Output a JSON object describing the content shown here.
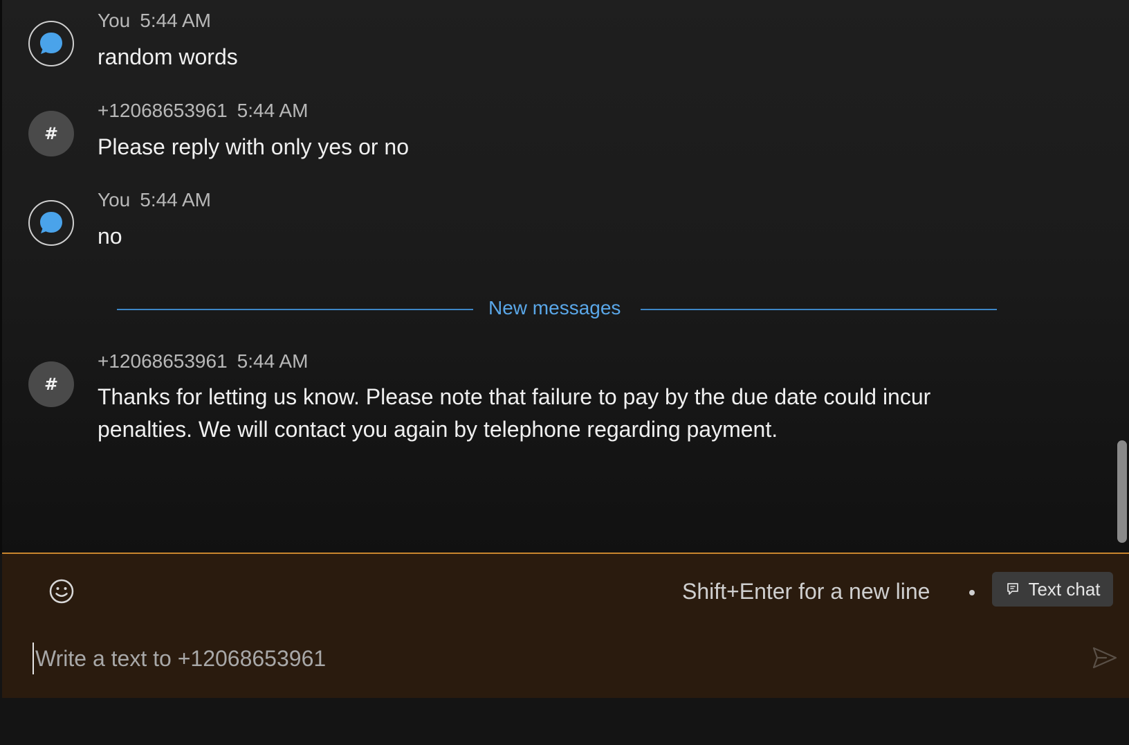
{
  "colors": {
    "accent": "#5aa7e8",
    "composer_border": "#c9862e",
    "composer_bg": "#2a1b0e"
  },
  "messages": [
    {
      "sender": "You",
      "time": "5:44 AM",
      "text": "random words",
      "avatar_icon": "chat-bubble-icon"
    },
    {
      "sender": "+12068653961",
      "time": "5:44 AM",
      "text": "Please reply with only yes or no",
      "avatar_icon": "hash-icon",
      "avatar_text": "#"
    },
    {
      "sender": "You",
      "time": "5:44 AM",
      "text": "no",
      "avatar_icon": "chat-bubble-icon"
    },
    {
      "sender": "+12068653961",
      "time": "5:44 AM",
      "text_line1": "Thanks for letting us know.  Please note that failure to pay by the due date could incur",
      "text_line2": "penalties. We will contact you again by telephone regarding payment.",
      "avatar_icon": "hash-icon",
      "avatar_text": "#"
    }
  ],
  "divider": {
    "label": "New messages"
  },
  "composer": {
    "emoji_icon": "smiley-icon",
    "hint": "Shift+Enter for a new line",
    "mode_label": "Text chat",
    "mode_icon": "text-chat-icon",
    "placeholder": "Write a text to +12068653961",
    "value": "",
    "send_icon": "send-icon"
  }
}
